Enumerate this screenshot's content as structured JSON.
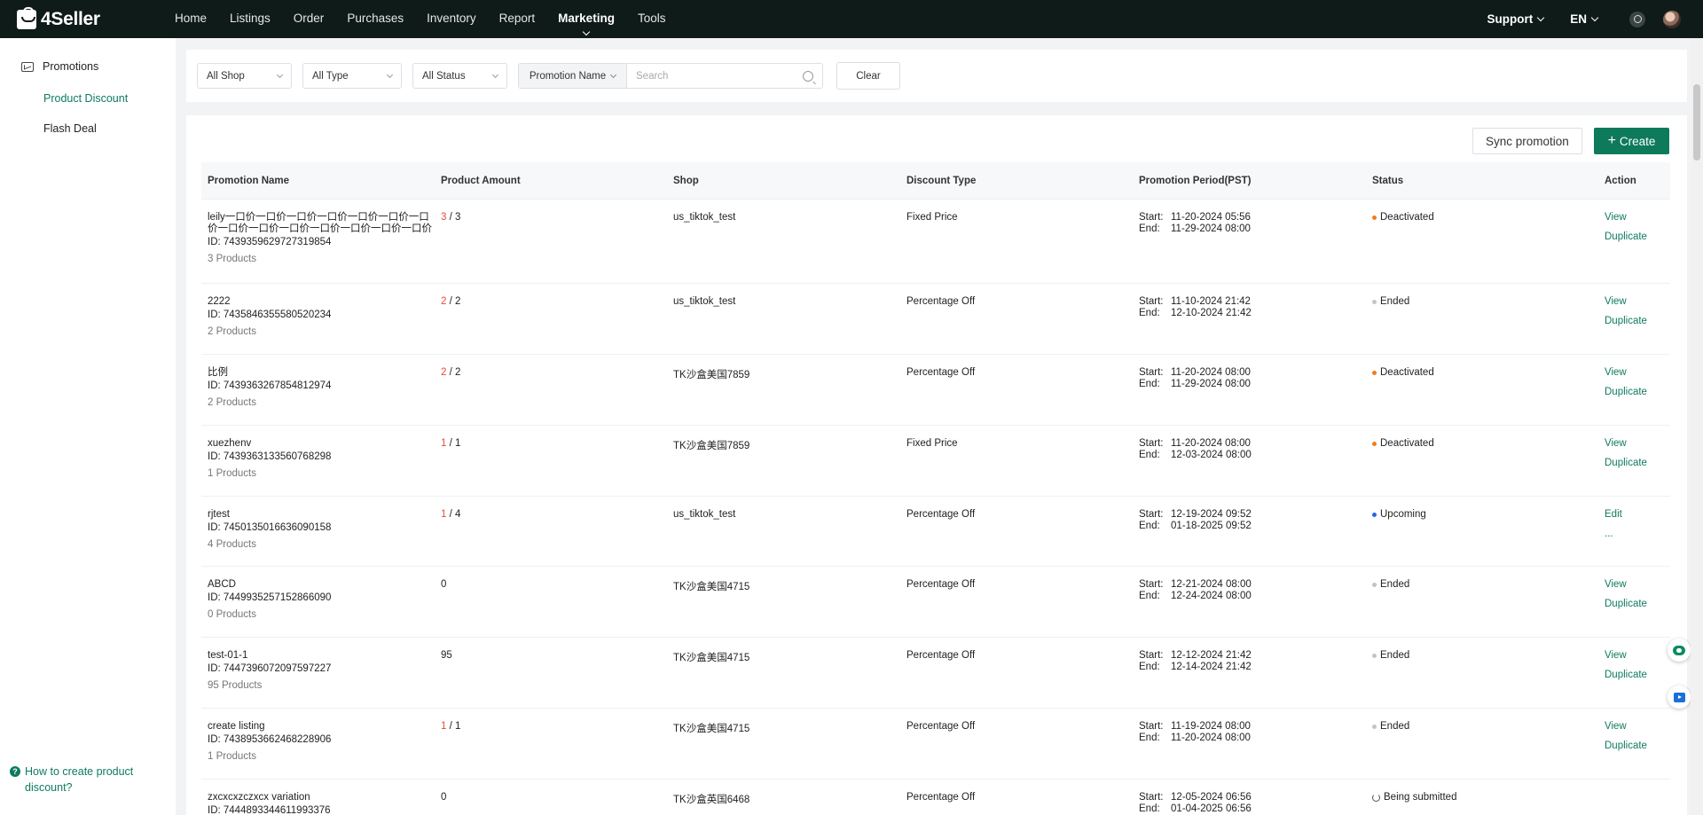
{
  "header": {
    "logo_text": "4Seller",
    "nav": [
      "Home",
      "Listings",
      "Order",
      "Purchases",
      "Inventory",
      "Report",
      "Marketing",
      "Tools"
    ],
    "active_nav": "Marketing",
    "support": "Support",
    "language": "EN"
  },
  "sidebar": {
    "group": "Promotions",
    "items": [
      "Product Discount",
      "Flash Deal"
    ],
    "active_item": "Product Discount",
    "help": "How to create product discount?"
  },
  "filters": {
    "shop": "All Shop",
    "type": "All Type",
    "status": "All Status",
    "search_field": "Promotion Name",
    "search_placeholder": "Search",
    "clear": "Clear"
  },
  "toolbar": {
    "sync": "Sync promotion",
    "create": "Create"
  },
  "table": {
    "columns": [
      "Promotion Name",
      "Product Amount",
      "Shop",
      "Discount Type",
      "Promotion Period(PST)",
      "Status",
      "Action"
    ],
    "period_labels": {
      "start": "Start:",
      "end": "End:"
    },
    "rows": [
      {
        "name": "leily一口价一口价一口价一口价一口价一口价一口价一口价一口价一口价一口价一口价一口价一口价",
        "id": "ID: 7439359629727319854",
        "products": "3 Products",
        "amount_selected": "3",
        "amount_total": " / 3",
        "shop": "us_tiktok_test",
        "discount": "Fixed Price",
        "start": "11-20-2024 05:56",
        "end": "11-29-2024 08:00",
        "status": "Deactivated",
        "status_type": "dot",
        "status_color": "#f07c1b",
        "actions": [
          "View",
          "Duplicate"
        ]
      },
      {
        "name": "2222",
        "id": "ID: 7435846355580520234",
        "products": "2 Products",
        "amount_selected": "2",
        "amount_total": " / 2",
        "shop": "us_tiktok_test",
        "discount": "Percentage Off",
        "start": "11-10-2024 21:42",
        "end": "12-10-2024 21:42",
        "status": "Ended",
        "status_type": "dot",
        "status_color": "#c0c4cc",
        "actions": [
          "View",
          "Duplicate"
        ]
      },
      {
        "name": "比例",
        "id": "ID: 7439363267854812974",
        "products": "2 Products",
        "amount_selected": "2",
        "amount_total": " / 2",
        "shop": "TK沙盒美国7859",
        "discount": "Percentage Off",
        "start": "11-20-2024 08:00",
        "end": "11-29-2024 08:00",
        "status": "Deactivated",
        "status_type": "dot",
        "status_color": "#f07c1b",
        "actions": [
          "View",
          "Duplicate"
        ]
      },
      {
        "name": "xuezhenv",
        "id": "ID: 7439363133560768298",
        "products": "1 Products",
        "amount_selected": "1",
        "amount_total": " / 1",
        "shop": "TK沙盒美国7859",
        "discount": "Fixed Price",
        "start": "11-20-2024 08:00",
        "end": "12-03-2024 08:00",
        "status": "Deactivated",
        "status_type": "dot",
        "status_color": "#f07c1b",
        "actions": [
          "View",
          "Duplicate"
        ]
      },
      {
        "name": "rjtest",
        "id": "ID: 7450135016636090158",
        "products": "4 Products",
        "amount_selected": "1",
        "amount_total": " / 4",
        "shop": "us_tiktok_test",
        "discount": "Percentage Off",
        "start": "12-19-2024 09:52",
        "end": "01-18-2025 09:52",
        "status": "Upcoming",
        "status_type": "dot",
        "status_color": "#2169e8",
        "actions": [
          "Edit",
          "..."
        ]
      },
      {
        "name": "ABCD",
        "id": "ID: 7449935257152866090",
        "products": "0 Products",
        "amount_selected": "",
        "amount_total": "0",
        "shop": "TK沙盒美国4715",
        "discount": "Percentage Off",
        "start": "12-21-2024 08:00",
        "end": "12-24-2024 08:00",
        "status": "Ended",
        "status_type": "dot",
        "status_color": "#c0c4cc",
        "actions": [
          "View",
          "Duplicate"
        ]
      },
      {
        "name": "test-01-1",
        "id": "ID: 7447396072097597227",
        "products": "95 Products",
        "amount_selected": "",
        "amount_total": "95",
        "shop": "TK沙盒美国4715",
        "discount": "Percentage Off",
        "start": "12-12-2024 21:42",
        "end": "12-14-2024 21:42",
        "status": "Ended",
        "status_type": "dot",
        "status_color": "#c0c4cc",
        "actions": [
          "View",
          "Duplicate"
        ]
      },
      {
        "name": "create listing",
        "id": "ID: 7438953662468228906",
        "products": "1 Products",
        "amount_selected": "1",
        "amount_total": " / 1",
        "shop": "TK沙盒美国4715",
        "discount": "Percentage Off",
        "start": "11-19-2024 08:00",
        "end": "11-20-2024 08:00",
        "status": "Ended",
        "status_type": "dot",
        "status_color": "#c0c4cc",
        "actions": [
          "View",
          "Duplicate"
        ]
      },
      {
        "name": "zxcxcxzczxcx variation",
        "id": "ID: 7444893344611993376",
        "products": "",
        "amount_selected": "",
        "amount_total": "0",
        "shop": "TK沙盒英国6468",
        "discount": "Percentage Off",
        "start": "12-05-2024 06:56",
        "end": "01-04-2025 06:56",
        "status": "Being submitted",
        "status_type": "spinner",
        "status_color": "#555555",
        "actions": []
      }
    ]
  },
  "floating": {
    "chat_icon": "chat-icon",
    "video_icon": "video-icon"
  }
}
